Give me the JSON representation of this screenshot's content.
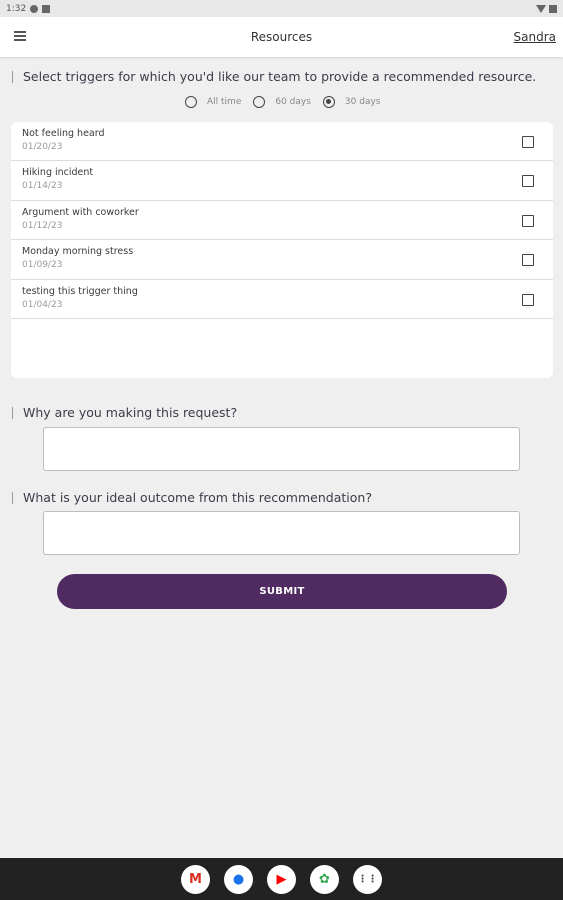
{
  "status_bar": {
    "time": "1:32"
  },
  "header": {
    "title": "Resources",
    "user": "Sandra"
  },
  "triggers_section": {
    "prompt": "Select triggers for which you'd like our team to provide a recommended resource.",
    "ranges": [
      {
        "label": "All time",
        "selected": false
      },
      {
        "label": "60 days",
        "selected": false
      },
      {
        "label": "30 days",
        "selected": true
      }
    ],
    "items": [
      {
        "name": "Not feeling heard",
        "date": "01/20/23"
      },
      {
        "name": "Hiking incident",
        "date": "01/14/23"
      },
      {
        "name": "Argument with coworker",
        "date": "01/12/23"
      },
      {
        "name": "Monday morning stress",
        "date": "01/09/23"
      },
      {
        "name": "testing this trigger thing",
        "date": "01/04/23"
      }
    ]
  },
  "request_question": {
    "label": "Why are you making this request?",
    "value": ""
  },
  "outcome_question": {
    "label": "What is your ideal outcome from this recommendation?",
    "value": ""
  },
  "submit": {
    "label": "SUBMIT",
    "color": "#4f2b62"
  },
  "nav_apps": [
    {
      "name": "gmail-icon",
      "glyph": "M",
      "color": "#d93025"
    },
    {
      "name": "chrome-icon",
      "glyph": "●",
      "color": "#1a73e8"
    },
    {
      "name": "youtube-icon",
      "glyph": "▶",
      "color": "#ff0000"
    },
    {
      "name": "photos-icon",
      "glyph": "✿",
      "color": "#34a853"
    },
    {
      "name": "app-drawer-icon",
      "glyph": "⋮⋮",
      "color": "#3c4043"
    }
  ]
}
